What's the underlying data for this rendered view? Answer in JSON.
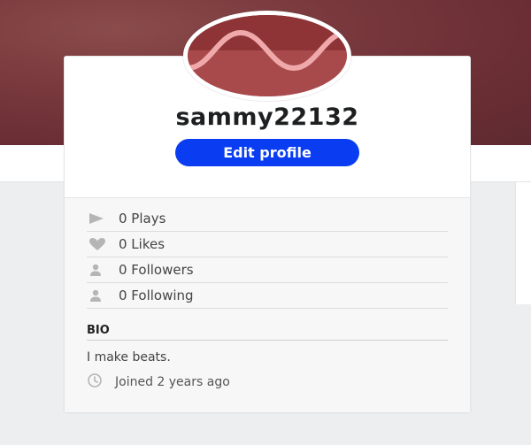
{
  "profile": {
    "username": "sammy22132",
    "edit_button_label": "Edit profile"
  },
  "stats": {
    "plays_label": "0 Plays",
    "likes_label": "0 Likes",
    "followers_label": "0 Followers",
    "following_label": "0 Following"
  },
  "bio": {
    "heading": "BIO",
    "text": "I make beats.",
    "joined": "Joined 2 years ago"
  },
  "icons": {
    "plays": "play-icon",
    "likes": "heart-icon",
    "followers": "user-icon",
    "following": "user-icon",
    "joined": "clock-icon"
  },
  "colors": {
    "banner": "#6a2e34",
    "avatar": "#a84a4c",
    "accent_button": "#0a3df2",
    "icon_gray": "#b5b5b5"
  }
}
